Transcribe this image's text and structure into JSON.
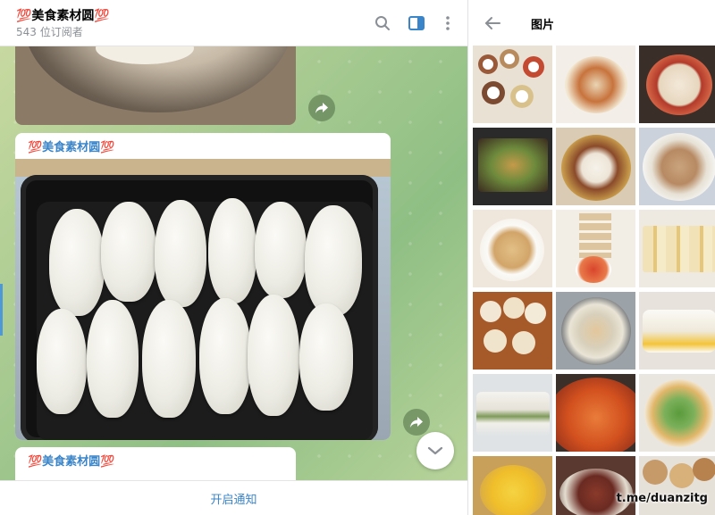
{
  "chat": {
    "title": "💯美食素材圆💯",
    "subscribers": "543 位订阅者",
    "messages": [
      {
        "author": "💯美食素材圆💯"
      },
      {
        "author": "💯美食素材圆💯"
      }
    ],
    "notify_label": "开启通知"
  },
  "header_icons": [
    "search-icon",
    "sidebar-toggle-icon",
    "more-vertical-icon"
  ],
  "media_panel": {
    "title": "图片",
    "back_icon": "arrow-left-icon",
    "photo_count": 18
  },
  "watermark": "t.me/duanzitg",
  "colors": {
    "accent": "#3a84c9",
    "sidebar_toggle_active": "#3a84c9",
    "chat_background": "#a9cb92"
  }
}
